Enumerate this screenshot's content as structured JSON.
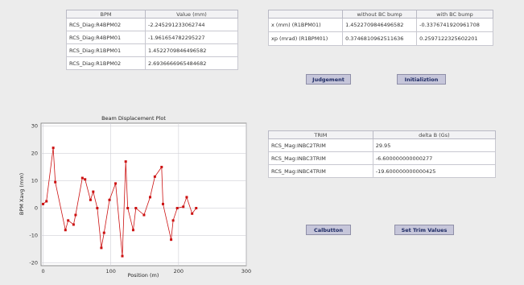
{
  "bpm_table": {
    "headers": [
      "BPM",
      "Value (mm)"
    ],
    "rows": [
      [
        "RCS_Diag:R4BPM02",
        "-2.245291233062744"
      ],
      [
        "RCS_Diag:R4BPM01",
        "-1.961654782295227"
      ],
      [
        "RCS_Diag:R1BPM01",
        "1.4522709846496582"
      ],
      [
        "RCS_Diag:R1BPM02",
        "2.6936666965484682"
      ]
    ]
  },
  "bump_table": {
    "headers": [
      "",
      "without BC bump",
      "with BC bump"
    ],
    "rows": [
      [
        "x (mm)      (R1BPM01)",
        "1.4522709846496582",
        "-0.33767419209617​08"
      ],
      [
        "xp (mrad) (R1BPM01)",
        "0.3746810962511636",
        "0.2597122325602201"
      ]
    ]
  },
  "buttons": {
    "judgement": "Judgement",
    "initialization": "Initializtion",
    "calbutton": "Calbutton",
    "set_trim": "Set Trim Values"
  },
  "trim_table": {
    "headers": [
      "TRIM",
      "delta B (Gs)"
    ],
    "rows": [
      [
        "RCS_Mag:INBC2TRIM",
        "29.95"
      ],
      [
        "RCS_Mag:INBC3TRIM",
        "-6.600000000000277"
      ],
      [
        "RCS_Mag:INBC4TRIM",
        "-19.600000000000425"
      ]
    ]
  },
  "colors": {
    "series": "#cc1111",
    "button_text": "#1d2a63",
    "button_bg": "#c6c6da"
  },
  "chart_data": {
    "type": "line",
    "title": "Beam Displacement Plot",
    "xlabel": "Position (m)",
    "ylabel": "BPM Xavg (mm)",
    "xlim": [
      -3,
      300
    ],
    "ylim": [
      -21,
      31
    ],
    "xticks": [
      0,
      100,
      200,
      300
    ],
    "yticks": [
      -20,
      -10,
      0,
      10,
      20,
      30
    ],
    "grid": true,
    "series": [
      {
        "x": [
          0,
          5,
          15,
          18,
          33,
          37,
          45,
          48,
          58,
          62,
          70,
          74,
          80,
          86,
          90,
          98,
          107,
          117,
          122,
          125,
          133,
          137,
          149,
          158,
          165,
          175,
          177,
          189,
          192,
          198,
          207,
          212,
          220,
          226
        ],
        "y": [
          1.5,
          2.5,
          22,
          9.5,
          -8,
          -4.5,
          -6,
          -2.5,
          11,
          10.5,
          3,
          6,
          0,
          -14.5,
          -9,
          3,
          9,
          -17.5,
          17,
          0,
          -8,
          0,
          -2.5,
          4,
          11.5,
          15,
          1.5,
          -11.5,
          -4.5,
          0,
          0.5,
          4,
          -2,
          0
        ]
      }
    ]
  }
}
